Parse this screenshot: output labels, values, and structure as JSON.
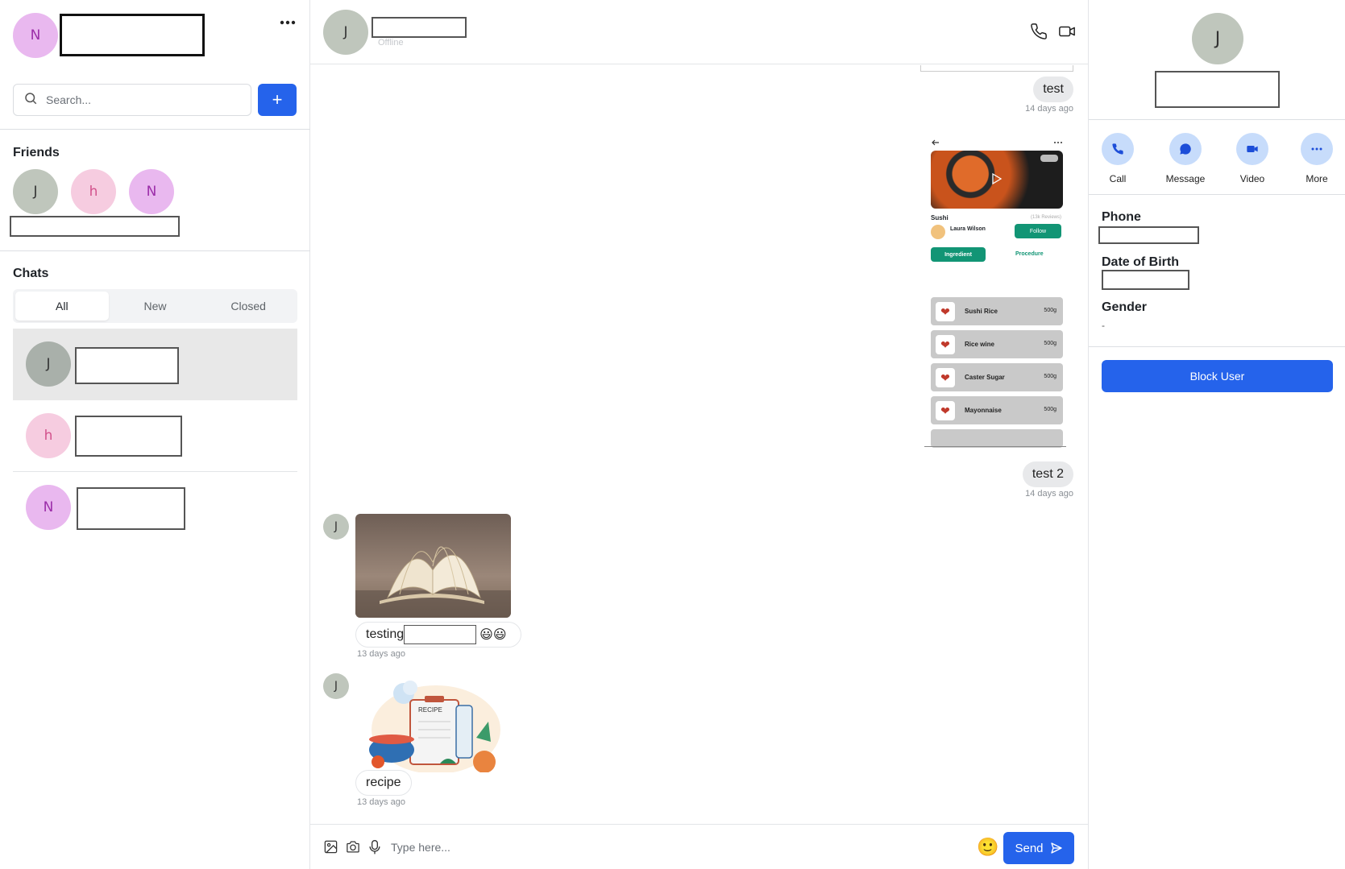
{
  "me": {
    "avatar_initial": "N"
  },
  "search": {
    "placeholder": "Search..."
  },
  "add_button": {
    "label": "+"
  },
  "friends": {
    "title": "Friends",
    "avatars": [
      "J",
      "h",
      "N"
    ]
  },
  "chats": {
    "title": "Chats",
    "tabs": [
      "All",
      "New",
      "Closed"
    ],
    "active_tab": "All",
    "items": [
      {
        "initial": "J",
        "selected": true
      },
      {
        "initial": "h",
        "selected": false
      },
      {
        "initial": "N",
        "selected": false
      }
    ]
  },
  "conversation": {
    "avatar_initial": "J",
    "status": "Offline",
    "messages": [
      {
        "direction": "out",
        "text": "test",
        "time": "14 days ago"
      },
      {
        "direction": "out",
        "type": "image",
        "image": {
          "kind": "app-screenshot",
          "dish": "Sushi",
          "reviews": "(13k Reviews)",
          "author": "Laura Wilson",
          "follow": "Follow",
          "tab_ingredient": "Ingredient",
          "tab_procedure": "Procedure",
          "ingredients": [
            {
              "name": "Sushi Rice",
              "amount": "500g"
            },
            {
              "name": "Rice wine",
              "amount": "500g"
            },
            {
              "name": "Caster Sugar",
              "amount": "500g"
            },
            {
              "name": "Mayonnaise",
              "amount": "500g"
            }
          ]
        }
      },
      {
        "direction": "out",
        "text": "test 2",
        "time": "14 days ago"
      },
      {
        "direction": "in",
        "avatar_initial": "J",
        "type": "image",
        "image": {
          "kind": "open-book-photo"
        },
        "text_before": "testing",
        "text_after": "😃😃",
        "time": "13 days ago"
      },
      {
        "direction": "in",
        "avatar_initial": "J",
        "type": "image",
        "image": {
          "kind": "recipe-illustration",
          "caption": "RECIPE"
        },
        "text": "recipe",
        "time": "13 days ago"
      }
    ]
  },
  "composer": {
    "placeholder": "Type here...",
    "send_label": "Send"
  },
  "profile": {
    "avatar_initial": "J",
    "actions": [
      {
        "label": "Call",
        "icon": "phone-icon"
      },
      {
        "label": "Message",
        "icon": "chat-bubble-icon"
      },
      {
        "label": "Video",
        "icon": "video-icon"
      },
      {
        "label": "More",
        "icon": "more-horizontal-icon"
      }
    ],
    "fields": {
      "phone_label": "Phone",
      "dob_label": "Date of Birth",
      "gender_label": "Gender",
      "gender_value": "-"
    },
    "block_label": "Block User"
  },
  "colors": {
    "primary": "#2563eb",
    "action_circle": "#c7dcfb",
    "selected_row": "#e8e8e8"
  }
}
